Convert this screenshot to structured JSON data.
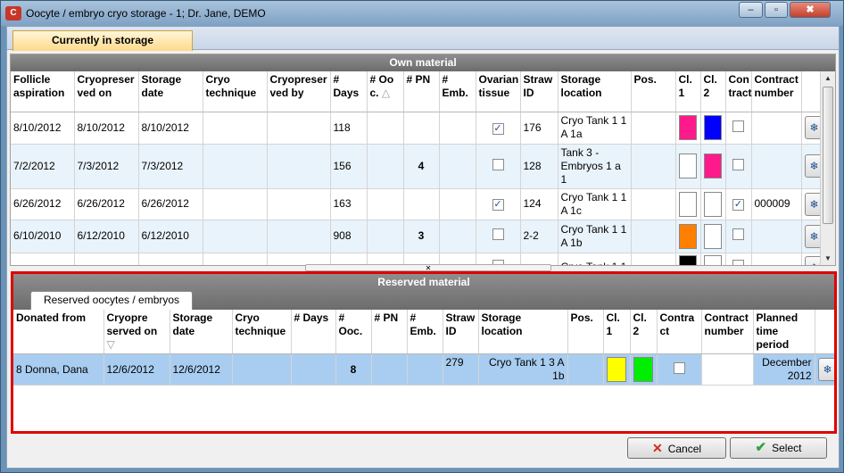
{
  "window": {
    "title": "Oocyte / embryo cryo storage - 1; Dr. Jane, DEMO",
    "icon": "app-logo-icon",
    "controls": {
      "minimize": "‒",
      "maximize": "▫",
      "close": "✖"
    }
  },
  "tabs": [
    {
      "label": "Currently in storage",
      "active": true
    }
  ],
  "own": {
    "title": "Own material",
    "columns": [
      "Follicle aspiration",
      "Cryopreser ved on",
      "Storage date",
      "Cryo technique",
      "Cryopreser ved by",
      "# Days",
      "# Oo c.",
      "# PN",
      "# Emb.",
      "Ovarian tissue",
      "Straw ID",
      "Storage location",
      "Pos.",
      "Cl. 1",
      "Cl. 2",
      "Con tract",
      "Contract number",
      ""
    ],
    "sort_indicator": "△",
    "rows": [
      {
        "aspiration": "8/10/2012",
        "cryo_on": "8/10/2012",
        "storage_date": "8/10/2012",
        "days": "118",
        "pn": "",
        "ovarian": true,
        "straw": "176",
        "location": "Cryo Tank 1 1 A 1a",
        "cl1": "#ff1a8c",
        "cl2": "#0000ff",
        "contract": false,
        "contract_no": ""
      },
      {
        "aspiration": "7/2/2012",
        "cryo_on": "7/3/2012",
        "storage_date": "7/3/2012",
        "days": "156",
        "pn": "4",
        "ovarian": false,
        "straw": "128",
        "location": "Tank 3 - Embryos 1 a 1",
        "cl1": "#ffffff",
        "cl2": "#ff1a8c",
        "contract": false,
        "contract_no": ""
      },
      {
        "aspiration": "6/26/2012",
        "cryo_on": "6/26/2012",
        "storage_date": "6/26/2012",
        "days": "163",
        "pn": "",
        "ovarian": true,
        "straw": "124",
        "location": "Cryo Tank 1 1 A 1c",
        "cl1": "#ffffff",
        "cl2": "#ffffff",
        "contract": true,
        "contract_no": "000009"
      },
      {
        "aspiration": "6/10/2010",
        "cryo_on": "6/12/2010",
        "storage_date": "6/12/2010",
        "days": "908",
        "pn": "3",
        "ovarian": false,
        "straw": "2-2",
        "location": "Cryo Tank 1 1 A 1b",
        "cl1": "#ff7f00",
        "cl2": "#ffffff",
        "contract": false,
        "contract_no": ""
      },
      {
        "aspiration": "",
        "cryo_on": "",
        "storage_date": "",
        "days": "",
        "pn": "",
        "ovarian": false,
        "straw": "",
        "location": "Cryo Tank 1 1",
        "cl1": "#000000",
        "cl2": "#ffffff",
        "contract": false,
        "contract_no": ""
      }
    ]
  },
  "reserved": {
    "title": "Reserved material",
    "tab": "Reserved oocytes / embryos",
    "columns": [
      "Donated from",
      "Cryopre served on",
      "Storage date",
      "Cryo technique",
      "# Days",
      "# Ooc.",
      "# PN",
      "# Emb.",
      "Straw ID",
      "Storage location",
      "Pos.",
      "Cl. 1",
      "Cl. 2",
      "Contra ct",
      "Contract number",
      "Planned time period",
      ""
    ],
    "sort_indicator": "▽",
    "rows": [
      {
        "donated_from": "8 Donna, Dana",
        "cryo_on": "12/6/2012",
        "storage_date": "12/6/2012",
        "ooc": "8",
        "straw": "279",
        "location": "Cryo Tank 1 3 A 1b",
        "cl1": "#ffff00",
        "cl2": "#00ee00",
        "contract": false,
        "period": "December 2012"
      }
    ]
  },
  "footer": {
    "cancel": "Cancel",
    "select": "Select"
  },
  "colors": {
    "accent_red": "#e00000",
    "selection": "#a9cdf0"
  }
}
